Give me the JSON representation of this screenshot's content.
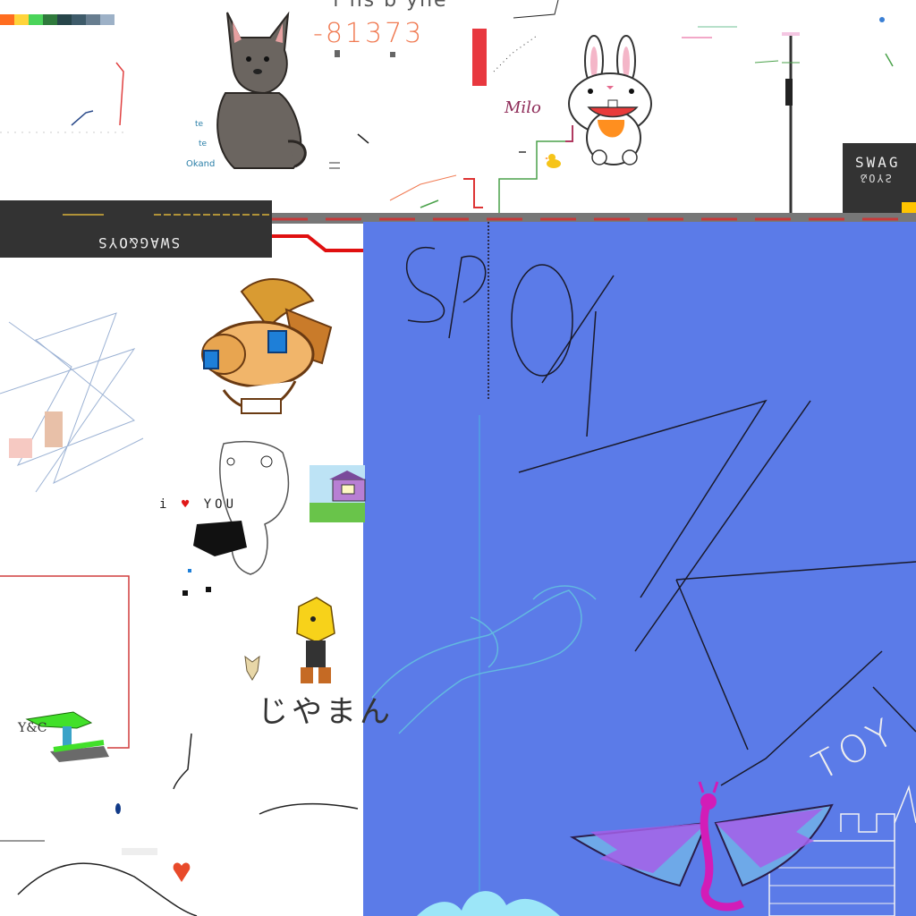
{
  "canvas": {
    "kind": "collaborative pixel drawing canvas",
    "background": "#ffffff",
    "accent_blue": "#5b7be8",
    "dark_panel": "#333333"
  },
  "texts": {
    "number_display": "-81373",
    "top_handwriting": "f ns b yne",
    "milo_label": "Milo",
    "label_te_1": "te",
    "label_te_2": "te",
    "label_okand": "Okand",
    "banner_left": "SWAG&OYS",
    "banner_right": "SWAG",
    "banner_right_sub": "&OYS",
    "i_love_you_prefix": "i",
    "i_love_you_suffix": "YOU",
    "japanese": "じやまん",
    "yc_initials": "Y&C",
    "spoon_scrawl": "SPOON",
    "toy_scrawl": "TOY"
  },
  "palette": [
    "#ff6d1f",
    "#ffd43b",
    "#4bd45a",
    "#2f7a3c",
    "#27454a",
    "#3e5b6a",
    "#677d8f",
    "#9db1c7"
  ],
  "icons": {
    "cat": "gray-cat-drawing-icon",
    "bunny": "white-bunny-drawing-icon",
    "rayman": "rayman-character-icon",
    "hedgehog": "yellow-hedgehog-character-icon",
    "dragon": "purple-dragon-drawing-icon",
    "duck": "yellow-duck-icon",
    "heart": "red-heart-icon",
    "crocodile": "green-crocodile-icon",
    "house": "house-scene-icon",
    "phoenix": "phoenix-outline-icon",
    "castle": "castle-outline-icon"
  }
}
